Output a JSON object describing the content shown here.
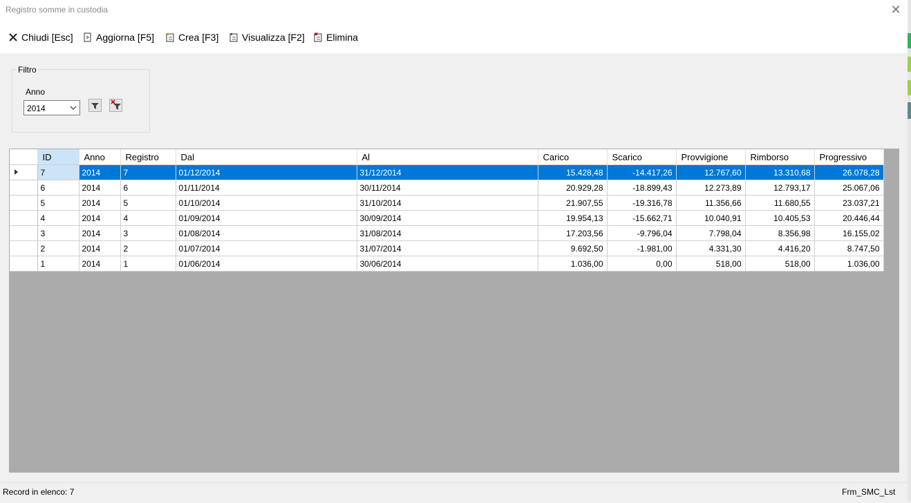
{
  "window": {
    "title": "Registro somme in custodia",
    "close_icon": "close-icon"
  },
  "toolbar": {
    "chiudi_label": "Chiudi [Esc]",
    "aggiorna_label": "Aggiorna [F5]",
    "crea_label": "Crea [F3]",
    "visualizza_label": "Visualizza [F2]",
    "elimina_label": "Elimina"
  },
  "filter": {
    "legend": "Filtro",
    "anno_label": "Anno",
    "anno_value": "2014",
    "apply_icon": "filter-icon",
    "clear_icon": "filter-clear-icon"
  },
  "grid": {
    "columns": [
      "ID",
      "Anno",
      "Registro",
      "Dal",
      "Al",
      "Carico",
      "Scarico",
      "Provvigione",
      "Rimborso",
      "Progressivo"
    ],
    "rows": [
      [
        "7",
        "2014",
        "7",
        "01/12/2014",
        "31/12/2014",
        "15.428,48",
        "-14.417,26",
        "12.767,60",
        "13.310,68",
        "26.078,28"
      ],
      [
        "6",
        "2014",
        "6",
        "01/11/2014",
        "30/11/2014",
        "20.929,28",
        "-18.899,43",
        "12.273,89",
        "12.793,17",
        "25.067,06"
      ],
      [
        "5",
        "2014",
        "5",
        "01/10/2014",
        "31/10/2014",
        "21.907,55",
        "-19.316,78",
        "11.356,66",
        "11.680,55",
        "23.037,21"
      ],
      [
        "4",
        "2014",
        "4",
        "01/09/2014",
        "30/09/2014",
        "19.954,13",
        "-15.662,71",
        "10.040,91",
        "10.405,53",
        "20.446,44"
      ],
      [
        "3",
        "2014",
        "3",
        "01/08/2014",
        "31/08/2014",
        "17.203,56",
        "-9.796,04",
        "7.798,04",
        "8.356,98",
        "16.155,02"
      ],
      [
        "2",
        "2014",
        "2",
        "01/07/2014",
        "31/07/2014",
        "9.692,50",
        "-1.981,00",
        "4.331,30",
        "4.416,20",
        "8.747,50"
      ],
      [
        "1",
        "2014",
        "1",
        "01/06/2014",
        "30/06/2014",
        "1.036,00",
        "0,00",
        "518,00",
        "518,00",
        "1.036,00"
      ]
    ],
    "selected_row": 0
  },
  "status": {
    "record_text": "Record in elenco: 7",
    "form_name": "Frm_SMC_Lst"
  },
  "colors": {
    "selection": "#0078d7",
    "header_selected": "#cce4f7",
    "grid_bg": "#ababab"
  }
}
